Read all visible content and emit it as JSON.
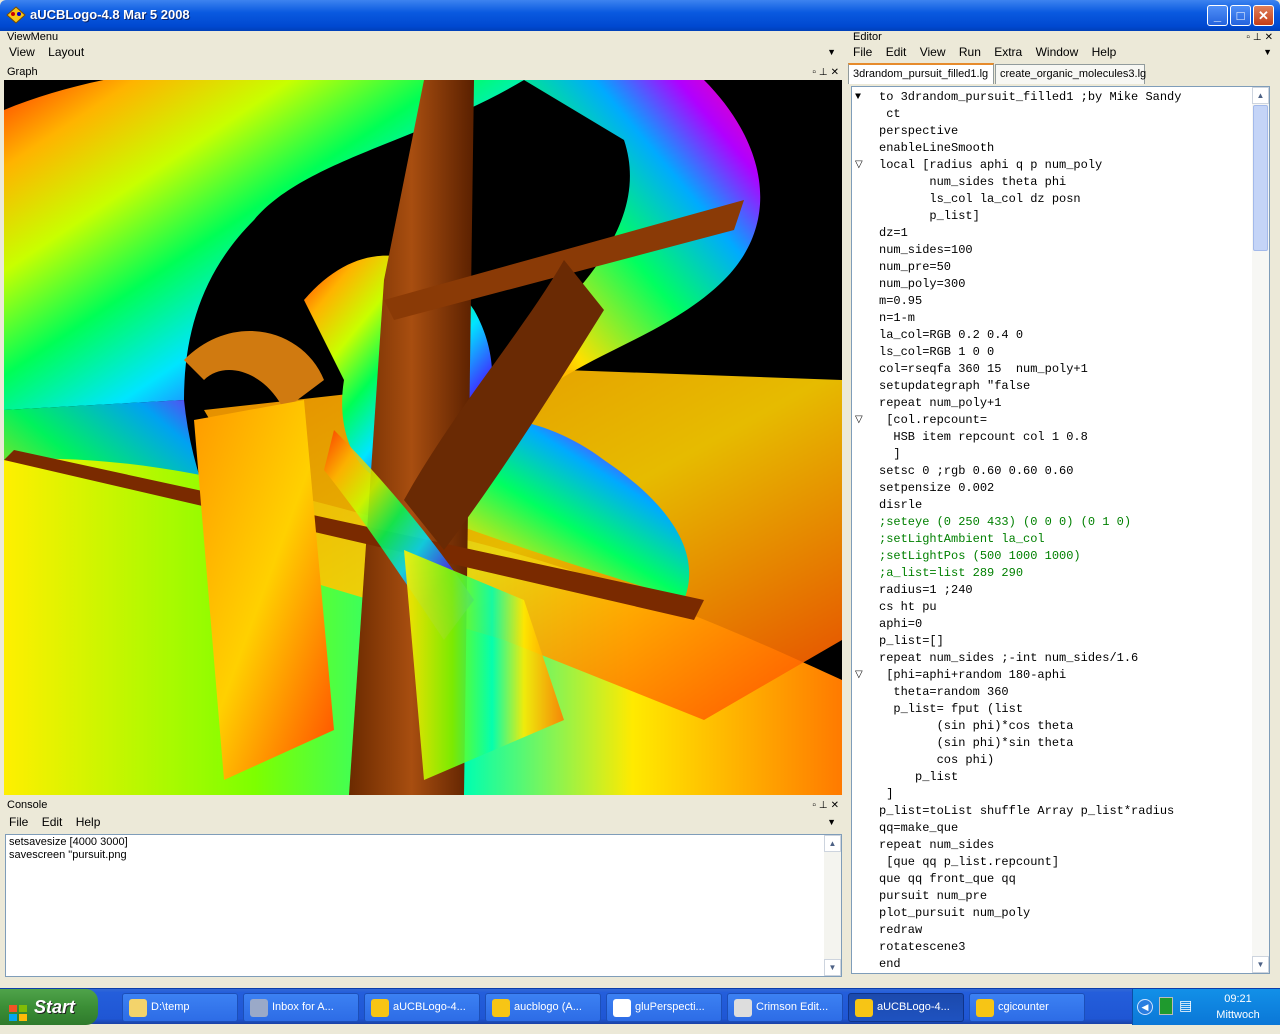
{
  "window": {
    "title": "aUCBLogo-4.8 Mar  5 2008",
    "min": "_",
    "max": "□",
    "close": "✕"
  },
  "viewmenu": {
    "title": "ViewMenu",
    "items": [
      "View",
      "Layout"
    ]
  },
  "graph": {
    "title": "Graph"
  },
  "console": {
    "title": "Console",
    "menu": [
      "File",
      "Edit",
      "Help"
    ],
    "lines": [
      "setsavesize [4000 3000]",
      "savescreen \"pursuit.png"
    ]
  },
  "editor": {
    "title": "Editor",
    "menu": [
      "File",
      "Edit",
      "View",
      "Run",
      "Extra",
      "Window",
      "Help"
    ],
    "tabs": [
      "3drandom_pursuit_filled1.lg",
      "create_organic_molecules3.lg"
    ],
    "code": [
      {
        "fold": "▼",
        "t": "to 3drandom_pursuit_filled1 ;by Mike Sandy"
      },
      {
        "fold": "",
        "t": " ct"
      },
      {
        "fold": "",
        "t": "perspective"
      },
      {
        "fold": "",
        "t": "enableLineSmooth"
      },
      {
        "fold": "▽",
        "t": "local [radius aphi q p num_poly"
      },
      {
        "fold": "",
        "t": "       num_sides theta phi"
      },
      {
        "fold": "",
        "t": "       ls_col la_col dz posn"
      },
      {
        "fold": "",
        "t": "       p_list]"
      },
      {
        "fold": "",
        "t": "dz=1"
      },
      {
        "fold": "",
        "t": "num_sides=100"
      },
      {
        "fold": "",
        "t": "num_pre=50"
      },
      {
        "fold": "",
        "t": "num_poly=300"
      },
      {
        "fold": "",
        "t": "m=0.95"
      },
      {
        "fold": "",
        "t": "n=1-m"
      },
      {
        "fold": "",
        "t": "la_col=RGB 0.2 0.4 0"
      },
      {
        "fold": "",
        "t": "ls_col=RGB 1 0 0"
      },
      {
        "fold": "",
        "t": "col=rseqfa 360 15  num_poly+1"
      },
      {
        "fold": "",
        "t": "setupdategraph \"false"
      },
      {
        "fold": "",
        "t": "repeat num_poly+1"
      },
      {
        "fold": "▽",
        "t": " [col.repcount="
      },
      {
        "fold": "",
        "t": "  HSB item repcount col 1 0.8"
      },
      {
        "fold": "",
        "t": "  ]"
      },
      {
        "fold": "",
        "t": "setsc 0 ;rgb 0.60 0.60 0.60"
      },
      {
        "fold": "",
        "t": "setpensize 0.002"
      },
      {
        "fold": "",
        "t": "disrle"
      },
      {
        "fold": "",
        "t": ";seteye (0 250 433) (0 0 0) (0 1 0)"
      },
      {
        "fold": "",
        "t": ";setLightAmbient la_col"
      },
      {
        "fold": "",
        "t": ";setLightPos (500 1000 1000)"
      },
      {
        "fold": "",
        "t": ";a_list=list 289 290"
      },
      {
        "fold": "",
        "t": "radius=1 ;240"
      },
      {
        "fold": "",
        "t": "cs ht pu"
      },
      {
        "fold": "",
        "t": "aphi=0"
      },
      {
        "fold": "",
        "t": "p_list=[]"
      },
      {
        "fold": "",
        "t": "repeat num_sides ;-int num_sides/1.6"
      },
      {
        "fold": "▽",
        "t": " [phi=aphi+random 180-aphi"
      },
      {
        "fold": "",
        "t": "  theta=random 360"
      },
      {
        "fold": "",
        "t": "  p_list= fput (list"
      },
      {
        "fold": "",
        "t": "        (sin phi)*cos theta"
      },
      {
        "fold": "",
        "t": "        (sin phi)*sin theta"
      },
      {
        "fold": "",
        "t": "        cos phi)"
      },
      {
        "fold": "",
        "t": "     p_list"
      },
      {
        "fold": "",
        "t": " ]"
      },
      {
        "fold": "",
        "t": "p_list=toList shuffle Array p_list*radius"
      },
      {
        "fold": "",
        "t": "qq=make_que"
      },
      {
        "fold": "",
        "t": "repeat num_sides"
      },
      {
        "fold": "",
        "t": " [que qq p_list.repcount]"
      },
      {
        "fold": "",
        "t": "que qq front_que qq"
      },
      {
        "fold": "",
        "t": "pursuit num_pre"
      },
      {
        "fold": "",
        "t": "plot_pursuit num_poly"
      },
      {
        "fold": "",
        "t": "redraw"
      },
      {
        "fold": "",
        "t": "rotatescene3"
      },
      {
        "fold": "",
        "t": "end"
      }
    ]
  },
  "taskbar": {
    "start": "Start",
    "tasks": [
      {
        "label": "D:\\temp",
        "icon": "folder-icon",
        "color": "#f3d36b"
      },
      {
        "label": "Inbox for A...",
        "icon": "mail-icon",
        "color": "#9aa9c8"
      },
      {
        "label": "aUCBLogo-4...",
        "icon": "logo-icon",
        "color": "#f7c515"
      },
      {
        "label": "aucblogo (A...",
        "icon": "editor-icon",
        "color": "#f7c515"
      },
      {
        "label": "gluPerspecti...",
        "icon": "help-icon",
        "color": "#ffffff"
      },
      {
        "label": "Crimson Edit...",
        "icon": "crimson-icon",
        "color": "#dddddd"
      },
      {
        "label": "aUCBLogo-4...",
        "icon": "logo-icon",
        "color": "#f7c515"
      },
      {
        "label": "cgicounter",
        "icon": "logo-icon",
        "color": "#f7c515"
      }
    ],
    "clock": "09:21",
    "day": "Mittwoch"
  }
}
